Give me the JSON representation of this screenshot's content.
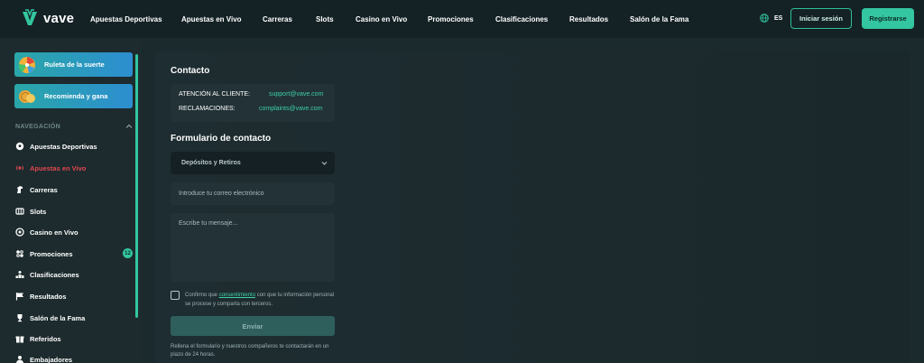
{
  "brand": {
    "name": "vave",
    "accent": "#33c6a0",
    "live_color": "#e0464f"
  },
  "topnav": [
    "Apuestas Deportivas",
    "Apuestas en Vivo",
    "Carreras",
    "Slots",
    "Casino en Vivo",
    "Promociones",
    "Clasificaciones",
    "Resultados",
    "Salón de la Fama"
  ],
  "header": {
    "lang": "ES",
    "login": "Iniciar sesión",
    "register": "Registrarse"
  },
  "sidebar": {
    "promos": [
      {
        "label": "Ruleta de la suerte",
        "icon": "wheel-icon"
      },
      {
        "label": "Recomienda y gana",
        "icon": "coins-icon"
      }
    ],
    "section_title": "NAVEGACIÓN",
    "items": [
      {
        "label": "Apuestas Deportivas",
        "icon": "soccer-ball-icon"
      },
      {
        "label": "Apuestas en Vivo",
        "icon": "live-icon",
        "active": true
      },
      {
        "label": "Carreras",
        "icon": "horse-icon"
      },
      {
        "label": "Slots",
        "icon": "slots-icon"
      },
      {
        "label": "Casino en Vivo",
        "icon": "chip-icon"
      },
      {
        "label": "Promociones",
        "icon": "gift-icon",
        "badge": "12"
      },
      {
        "label": "Clasificaciones",
        "icon": "leaderboard-icon"
      },
      {
        "label": "Resultados",
        "icon": "flag-icon"
      },
      {
        "label": "Salón de la Fama",
        "icon": "trophy-icon"
      },
      {
        "label": "Referidos",
        "icon": "gift-box-icon"
      },
      {
        "label": "Embajadores",
        "icon": "ambassador-icon"
      }
    ]
  },
  "contact": {
    "title": "Contacto",
    "rows": [
      {
        "label": "ATENCIÓN AL CLIENTE:",
        "email": "support@vave.com"
      },
      {
        "label": "RECLAMACIONES:",
        "email": "complaints@vave.com"
      }
    ]
  },
  "form": {
    "title": "Formulario de contacto",
    "select_value": "Depósitos y Retiros",
    "email_placeholder": "Introduce tu correo electrónico",
    "message_placeholder": "Escribe tu mensaje...",
    "consent_prefix": "Confirmo que ",
    "consent_link": "consentimiento",
    "consent_suffix": " con que tu información personal se procese y comparta con terceros.",
    "submit": "Enviar",
    "note": "Rellena el formulario y nuestros compañeros te contactarán en un plazo de 24 horas."
  }
}
